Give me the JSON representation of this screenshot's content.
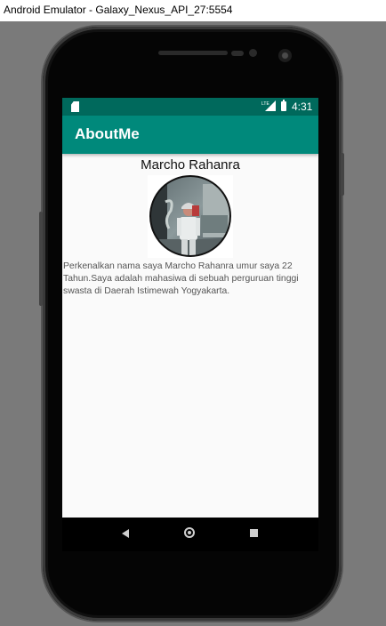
{
  "window": {
    "title": "Android Emulator - Galaxy_Nexus_API_27:5554"
  },
  "status_bar": {
    "time": "4:31",
    "network_label": "LTE",
    "color": "#00695c"
  },
  "app_bar": {
    "title": "AboutMe",
    "color": "#00897b"
  },
  "profile": {
    "name": "Marcho Rahanra",
    "bio": "Perkenalkan nama saya Marcho Rahanra umur saya 22 Tahun.Saya adalah mahasiwa di sebuah perguruan tinggi swasta di Daerah Istimewah Yogyakarta."
  },
  "nav_bar": {
    "icons": [
      "back-icon",
      "home-icon",
      "recent-apps-icon"
    ]
  }
}
